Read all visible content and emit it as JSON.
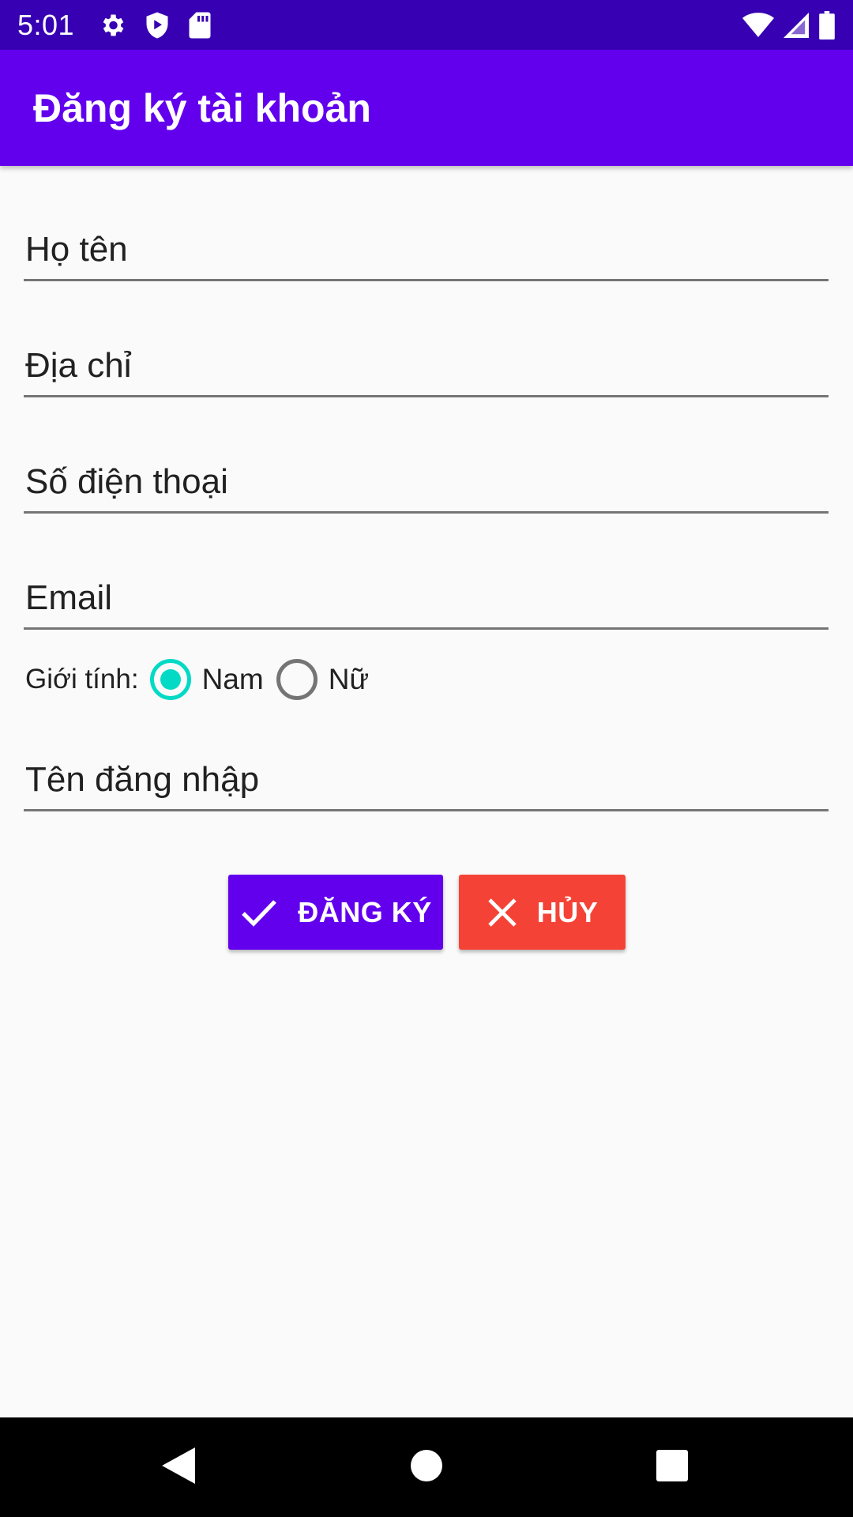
{
  "status_bar": {
    "time": "5:01",
    "left_icons": [
      "settings-icon",
      "shield-play-icon",
      "sd-card-icon"
    ],
    "right_icons": [
      "wifi-icon",
      "signal-icon",
      "battery-icon"
    ]
  },
  "app_bar": {
    "title": "Đăng ký tài khoản"
  },
  "form": {
    "full_name": {
      "placeholder": "Họ tên",
      "value": ""
    },
    "address": {
      "placeholder": "Địa chỉ",
      "value": ""
    },
    "phone": {
      "placeholder": "Số điện thoại",
      "value": ""
    },
    "email": {
      "placeholder": "Email",
      "value": ""
    },
    "gender": {
      "label": "Giới tính:",
      "options": [
        {
          "label": "Nam",
          "checked": true
        },
        {
          "label": "Nữ",
          "checked": false
        }
      ]
    },
    "username": {
      "placeholder": "Tên đăng nhập",
      "value": ""
    }
  },
  "buttons": {
    "register": {
      "label": "ĐĂNG KÝ",
      "icon": "check-icon"
    },
    "cancel": {
      "label": "HỦY",
      "icon": "close-icon"
    }
  },
  "nav_bar": {
    "icons": [
      "back-icon",
      "home-icon",
      "recents-icon"
    ]
  },
  "colors": {
    "primary": "#6200ee",
    "primary_dark": "#3700b3",
    "accent": "#03dac5",
    "cancel": "#f44336"
  }
}
